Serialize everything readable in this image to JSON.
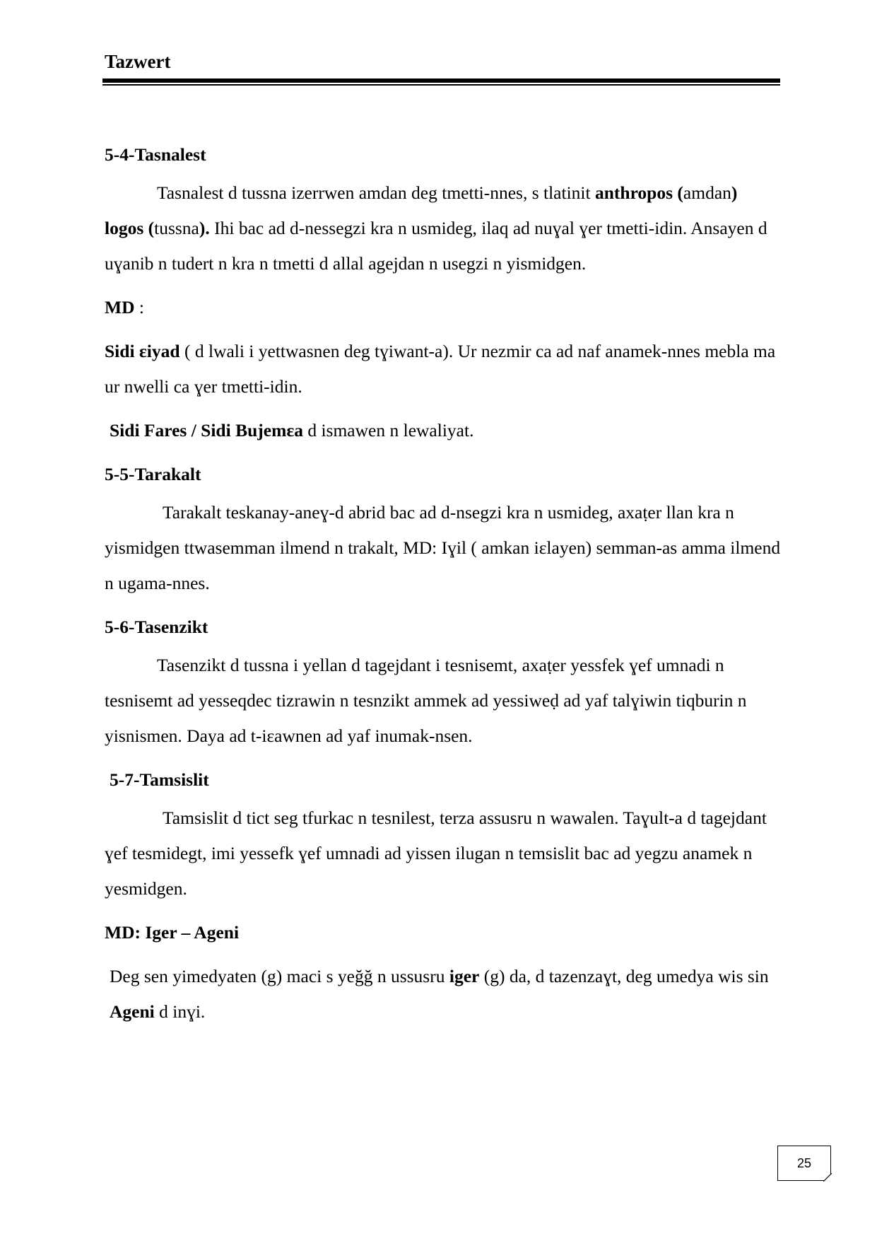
{
  "header": {
    "title": "Tazwert"
  },
  "sections": {
    "s54": {
      "heading": "5-4-Tasnalest",
      "p1": {
        "t1": "Tasnalest d tussna  izerrwen amdan deg tmetti-nnes, s tlatinit ",
        "b1": "anthropos",
        "t2": "",
        "b2": "(",
        "t3": "amdan",
        "b3": ") logos (",
        "t4": "tussna",
        "b4": ").",
        "t5": " Ihi bac ad d-nessegzi kra n usmideg, ilaq ad nuɣal ɣer tmetti-idin. Ansayen d uɣanib n tudert n kra n tmetti d allal agejdan n usegzi n yismidgen."
      },
      "md_label": "MD",
      "md_colon": " :",
      "ex1": {
        "bold": "Sidi ɛiyad",
        "text": " ( d lwali i yettwasnen deg tɣiwant-a). Ur nezmir ca ad naf anamek-nnes mebla ma ur nwelli ca ɣer tmetti-idin."
      },
      "ex2": {
        "bold": "Sidi Fares / Sidi Bujemɛa",
        "text": " d ismawen n lewaliyat."
      }
    },
    "s55": {
      "heading": "5-5-Tarakalt",
      "p1": "Tarakalt teskanay-aneɣ-d abrid bac ad d-nsegzi kra n usmideg, axaṭer llan kra n yismidgen ttwasemman ilmend n trakalt, MD: Iɣil ( amkan iɛlayen) semman-as amma ilmend n ugama-nnes."
    },
    "s56": {
      "heading": "5-6-Tasenzikt",
      "p1": "Tasenzikt d tussna i yellan d tagejdant i tesnisemt, axaṭer  yessfek ɣef umnadi n tesnisemt ad yesseqdec tizrawin n tesnzikt ammek  ad yessiweḍ ad yaf talɣiwin tiqburin n yisnismen. Daya ad t-iɛawnen ad yaf inumak-nsen."
    },
    "s57": {
      "heading": "5-7-Tamsislit",
      "p1": "Tamsislit d tict seg tfurkac n tesnilest, terza assusru n wawalen. Taɣult-a d tagejdant ɣef tesmidegt, imi yessefk ɣef umnadi ad yissen ilugan n temsislit bac ad yegzu anamek n yesmidgen.",
      "md_heading": "MD: Iger – Ageni",
      "ex": {
        "t1": "Deg sen yimedyaten (g) maci s yeğğ n ussusru ",
        "b1": "iger",
        "t2": " (g) da, d tazenzaɣt, deg umedya wis sin ",
        "b2": "Ageni",
        "t3": " d inɣi."
      }
    }
  },
  "footer": {
    "page_number": "25"
  }
}
